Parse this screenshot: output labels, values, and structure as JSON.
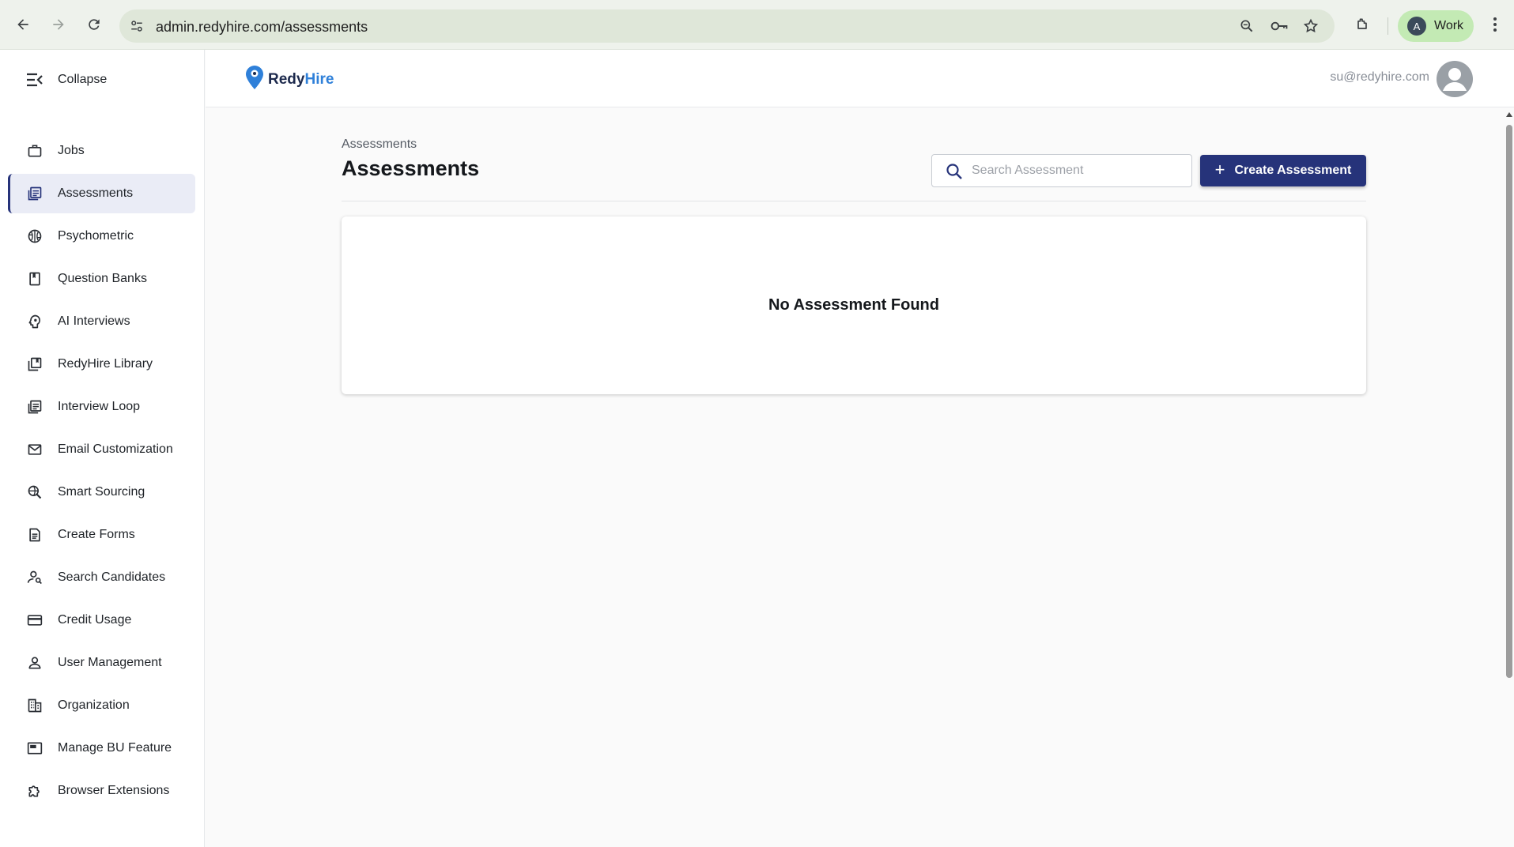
{
  "browser": {
    "url": "admin.redyhire.com/assessments",
    "profile_initial": "A",
    "profile_label": "Work"
  },
  "sidebar": {
    "collapse_label": "Collapse",
    "items": [
      {
        "label": "Jobs",
        "icon": "briefcase-icon"
      },
      {
        "label": "Assessments",
        "icon": "assessment-icon",
        "active": true
      },
      {
        "label": "Psychometric",
        "icon": "brain-icon"
      },
      {
        "label": "Question Banks",
        "icon": "bookmark-book-icon"
      },
      {
        "label": "AI Interviews",
        "icon": "psychology-head-icon"
      },
      {
        "label": "RedyHire Library",
        "icon": "library-books-icon"
      },
      {
        "label": "Interview Loop",
        "icon": "list-stack-icon"
      },
      {
        "label": "Email Customization",
        "icon": "mail-icon"
      },
      {
        "label": "Smart Sourcing",
        "icon": "travel-explore-icon"
      },
      {
        "label": "Create Forms",
        "icon": "document-icon"
      },
      {
        "label": "Search Candidates",
        "icon": "person-search-icon"
      },
      {
        "label": "Credit Usage",
        "icon": "credit-card-icon"
      },
      {
        "label": "User Management",
        "icon": "person-icon"
      },
      {
        "label": "Organization",
        "icon": "building-icon"
      },
      {
        "label": "Manage BU Feature",
        "icon": "featured-video-icon"
      },
      {
        "label": "Browser Extensions",
        "icon": "extension-puzzle-icon"
      }
    ]
  },
  "header": {
    "logo_part1": "Redy",
    "logo_part2": "Hire",
    "user_email": "su@redyhire.com"
  },
  "main": {
    "breadcrumb": "Assessments",
    "title": "Assessments",
    "search_placeholder": "Search Assessment",
    "create_button_label": "Create Assessment",
    "empty_message": "No Assessment Found"
  },
  "colors": {
    "primary": "#26337a",
    "logo_blue": "#2f80d9",
    "active_nav_bg": "#eaecf6",
    "profile_chip": "#c3eab4"
  }
}
